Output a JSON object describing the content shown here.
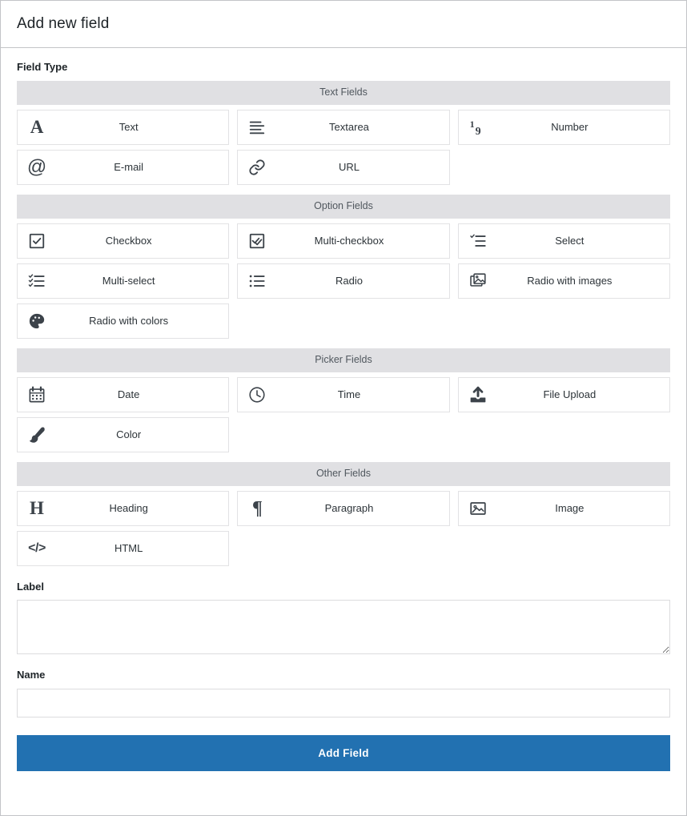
{
  "window": {
    "title": "Add new field"
  },
  "colors": {
    "primary": "#2271b1",
    "group_header_bg": "#e0e0e3",
    "border": "#c3c4c7",
    "text": "#1d2327"
  },
  "form": {
    "field_type_label": "Field Type",
    "label_label": "Label",
    "label_value": "",
    "label_placeholder": "",
    "name_label": "Name",
    "name_value": "",
    "name_placeholder": "",
    "submit_label": "Add Field"
  },
  "groups": [
    {
      "title": "Text Fields",
      "items": [
        {
          "label": "Text",
          "icon": "serif-a-icon"
        },
        {
          "label": "Textarea",
          "icon": "align-left-lines-icon"
        },
        {
          "label": "Number",
          "icon": "one-nine-number-icon"
        },
        {
          "label": "E-mail",
          "icon": "at-sign-icon"
        },
        {
          "label": "URL",
          "icon": "link-chain-icon"
        }
      ]
    },
    {
      "title": "Option Fields",
      "items": [
        {
          "label": "Checkbox",
          "icon": "checkbox-checked-icon"
        },
        {
          "label": "Multi-checkbox",
          "icon": "checkbox-double-check-icon"
        },
        {
          "label": "Select",
          "icon": "list-single-check-icon"
        },
        {
          "label": "Multi-select",
          "icon": "list-multi-check-icon"
        },
        {
          "label": "Radio",
          "icon": "bullet-list-icon"
        },
        {
          "label": "Radio with images",
          "icon": "stacked-images-icon"
        },
        {
          "label": "Radio with colors",
          "icon": "color-palette-icon"
        }
      ]
    },
    {
      "title": "Picker Fields",
      "items": [
        {
          "label": "Date",
          "icon": "calendar-icon"
        },
        {
          "label": "Time",
          "icon": "clock-icon"
        },
        {
          "label": "File Upload",
          "icon": "upload-arrow-icon"
        },
        {
          "label": "Color",
          "icon": "paintbrush-icon"
        }
      ]
    },
    {
      "title": "Other Fields",
      "items": [
        {
          "label": "Heading",
          "icon": "serif-h-icon"
        },
        {
          "label": "Paragraph",
          "icon": "pilcrow-icon"
        },
        {
          "label": "Image",
          "icon": "picture-frame-icon"
        },
        {
          "label": "HTML",
          "icon": "code-brackets-icon"
        }
      ]
    }
  ]
}
